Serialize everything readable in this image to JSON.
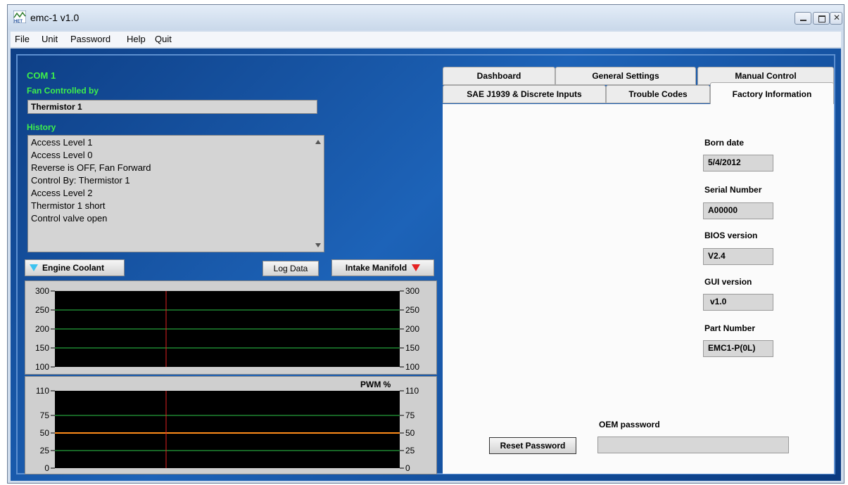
{
  "window": {
    "title": "emc-1 v1.0"
  },
  "menu": [
    "File",
    "Unit",
    "Password",
    "Help",
    "Quit"
  ],
  "left": {
    "com_port": "COM 1",
    "fan_controlled_label": "Fan Controlled by",
    "fan_controlled_value": "Thermistor 1",
    "history_label": "History",
    "history": [
      "Access Level 1",
      "Access Level 0",
      "Reverse is OFF, Fan Forward",
      "Control By: Thermistor 1",
      "Access Level 2",
      "Thermistor 1 short",
      "Control valve open"
    ],
    "engine_coolant_label": "Engine Coolant",
    "log_data_label": "Log Data",
    "intake_manifold_label": "Intake Manifold",
    "pwm_label": "PWM %"
  },
  "colors": {
    "coolant_marker": "#3ec3f0",
    "manifold_marker": "#e52222",
    "grid": "#2ec84a",
    "cursor": "#e02020",
    "pwm_line": "#ff8c1a"
  },
  "tabs": {
    "row1": [
      "Dashboard",
      "General Settings",
      "Manual Control"
    ],
    "row2": [
      "SAE J1939 & Discrete Inputs",
      "Trouble Codes",
      "Factory Information"
    ],
    "active": "Factory Information"
  },
  "factory": {
    "born_date_label": "Born date",
    "born_date": "5/4/2012",
    "serial_label": "Serial Number",
    "serial": "A00000",
    "bios_label": "BIOS version",
    "bios": "V2.4",
    "gui_label": "GUI version",
    "gui": "v1.0",
    "part_label": "Part Number",
    "part": "EMC1-P(0L)",
    "oem_password_label": "OEM password",
    "oem_password_value": "",
    "reset_password_label": "Reset Password"
  },
  "chart_data": [
    {
      "type": "line",
      "y_ticks": [
        300,
        250,
        200,
        150,
        100
      ],
      "ylim": [
        100,
        300
      ],
      "grid": true,
      "series": []
    },
    {
      "type": "line",
      "title": "PWM %",
      "y_ticks": [
        110,
        75,
        50,
        25,
        0
      ],
      "ylim": [
        0,
        110
      ],
      "grid": true,
      "series": [
        {
          "values": [
            50,
            50,
            50,
            50,
            50,
            50,
            50,
            50,
            50,
            50,
            50,
            50,
            50,
            50,
            50,
            50,
            50,
            50,
            50,
            50
          ]
        }
      ]
    }
  ]
}
